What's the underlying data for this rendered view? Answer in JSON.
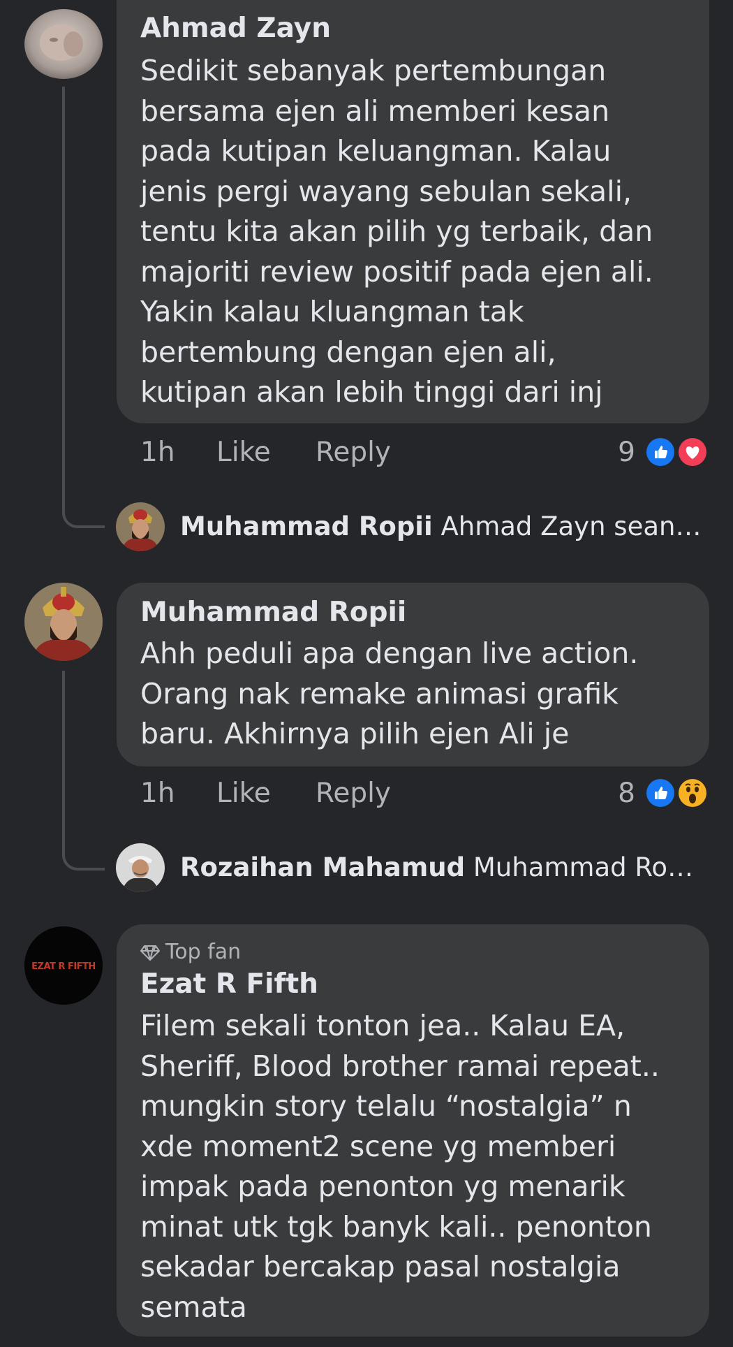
{
  "colors": {
    "background": "#252629",
    "bubble": "#3a3b3c",
    "text_primary": "#e4e6eb",
    "text_secondary": "#b0b3b8",
    "like_blue": "#1877f2",
    "love_red": "#f33e58",
    "wow_yellow": "#f7b125"
  },
  "comments": [
    {
      "author": "Ahmad Zayn",
      "badge": "",
      "text": "Sedikit sebanyak pertembungan\nbersama ejen ali memberi kesan\npada kutipan keluangman. Kalau\njenis pergi wayang sebulan sekali,\ntentu kita akan pilih yg terbaik, dan\nmajoriti review positif pada ejen ali.\nYakin kalau kluangman tak\nbertembung dengan ejen ali,\nkutipan akan lebih tinggi dari inj",
      "time": "1h",
      "like_label": "Like",
      "reply_label": "Reply",
      "reaction_count": "9",
      "reactions": [
        "like-icon",
        "love-icon"
      ],
      "reply_preview": {
        "author": "Muhammad Ropii",
        "snippet": "Ahmad Zayn seandai..."
      }
    },
    {
      "author": "Muhammad Ropii",
      "badge": "",
      "text": "Ahh peduli apa dengan live action.\nOrang nak remake animasi grafik\nbaru. Akhirnya pilih ejen Ali je",
      "time": "1h",
      "like_label": "Like",
      "reply_label": "Reply",
      "reaction_count": "8",
      "reactions": [
        "like-icon",
        "wow-icon"
      ],
      "reply_preview": {
        "author": "Rozaihan Mahamud",
        "snippet": "Muhammad Ropii t..."
      }
    },
    {
      "author": "Ezat R Fifth",
      "badge": "Top fan",
      "badge_icon": "diamond-icon",
      "avatar_text": "EZAT R FIFTH",
      "text": "Filem sekali tonton jea.. Kalau EA,\nSheriff, Blood brother ramai repeat..\nmungkin story telalu “nostalgia” n\nxde moment2 scene yg memberi\nimpak pada penonton yg menarik\nminat utk tgk banyk kali.. penonton\nsekadar bercakap pasal nostalgia\nsemata"
    }
  ]
}
